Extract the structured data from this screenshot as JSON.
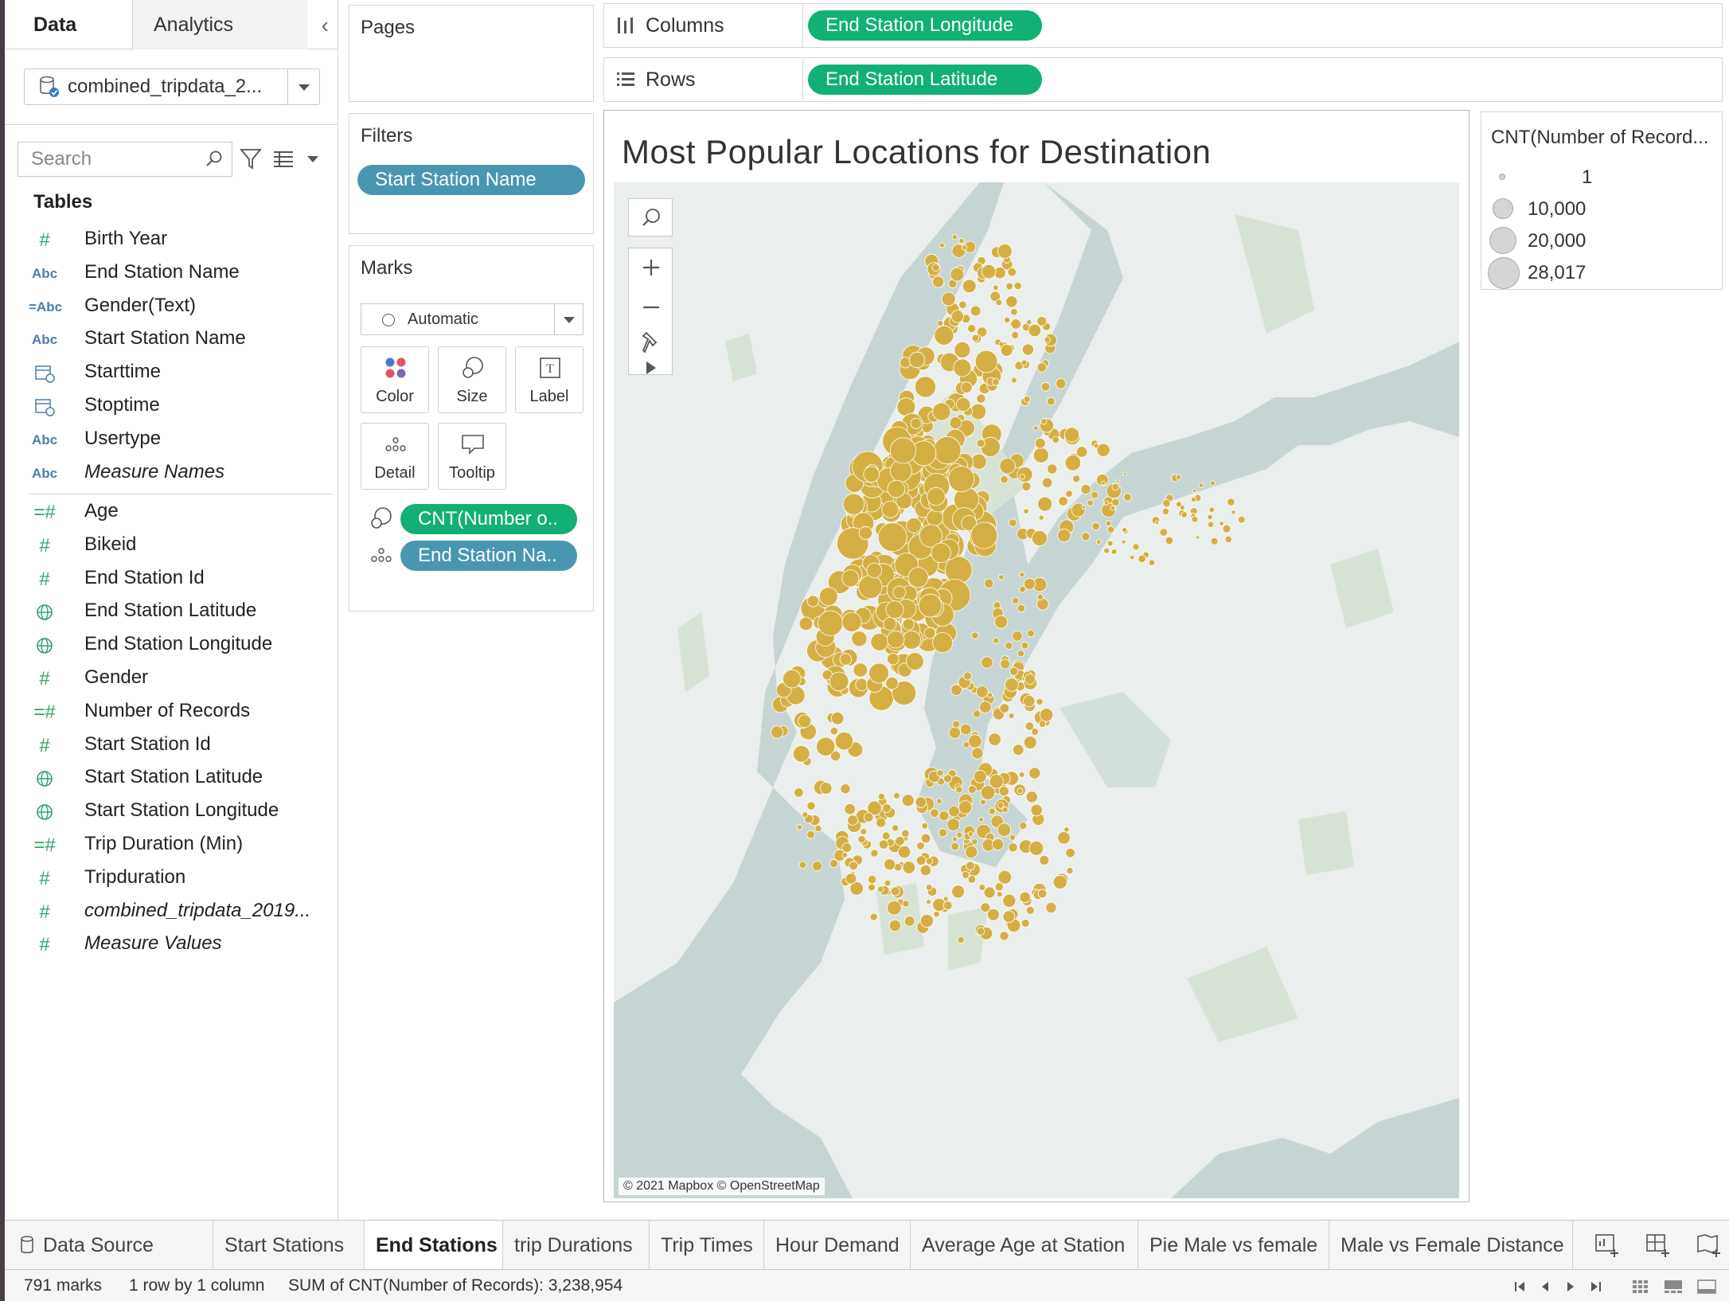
{
  "data_pane": {
    "tabs": [
      "Data",
      "Analytics"
    ],
    "datasource": "combined_tripdata_2...",
    "search_placeholder": "Search",
    "tables_heading": "Tables",
    "dimensions": [
      {
        "type": "#",
        "label": "Birth Year"
      },
      {
        "type": "Abc",
        "label": "End Station Name"
      },
      {
        "type": "=Abc",
        "label": "Gender(Text)"
      },
      {
        "type": "Abc",
        "label": "Start Station Name"
      },
      {
        "type": "date",
        "label": "Starttime"
      },
      {
        "type": "date",
        "label": "Stoptime"
      },
      {
        "type": "Abc",
        "label": "Usertype"
      },
      {
        "type": "Abc",
        "label": "Measure Names",
        "italic": true
      }
    ],
    "measures": [
      {
        "type": "=#",
        "label": "Age"
      },
      {
        "type": "#",
        "label": "Bikeid"
      },
      {
        "type": "#",
        "label": "End Station Id"
      },
      {
        "type": "geo",
        "label": "End Station Latitude"
      },
      {
        "type": "geo",
        "label": "End Station Longitude"
      },
      {
        "type": "#",
        "label": "Gender"
      },
      {
        "type": "=#",
        "label": "Number of Records"
      },
      {
        "type": "#",
        "label": "Start Station Id"
      },
      {
        "type": "geo",
        "label": "Start Station Latitude"
      },
      {
        "type": "geo",
        "label": "Start Station Longitude"
      },
      {
        "type": "=#",
        "label": "Trip Duration (Min)"
      },
      {
        "type": "#",
        "label": "Tripduration"
      },
      {
        "type": "#",
        "label": "combined_tripdata_2019...",
        "italic": true
      },
      {
        "type": "#",
        "label": "Measure Values",
        "italic": true
      }
    ]
  },
  "pages": {
    "title": "Pages"
  },
  "filters": {
    "title": "Filters",
    "pill": "Start Station Name"
  },
  "marks": {
    "title": "Marks",
    "type": "Automatic",
    "buttons": [
      "Color",
      "Size",
      "Label",
      "Detail",
      "Tooltip"
    ],
    "size_pill": "CNT(Number o..",
    "detail_pill": "End Station Na.."
  },
  "columns": {
    "label": "Columns",
    "pill": "End Station Longitude"
  },
  "rows": {
    "label": "Rows",
    "pill": "End Station Latitude"
  },
  "view": {
    "title": "Most Popular Locations for Destination",
    "attribution": "© 2021 Mapbox © OpenStreetMap",
    "mark_color": "#d4b044",
    "water_color": "#c6d5d3"
  },
  "legend": {
    "title": "CNT(Number of Record...",
    "items": [
      "1",
      "10,000",
      "20,000",
      "28,017"
    ]
  },
  "sheet_tabs": {
    "data_source": "Data Source",
    "tabs": [
      "Start Stations",
      "End Stations",
      "trip Durations",
      "Trip Times",
      "Hour Demand",
      "Average Age at Station",
      "Pie Male vs female",
      "Male vs Female Distance"
    ],
    "active": "End Stations"
  },
  "status": {
    "marks": "791 marks",
    "dims": "1 row by 1 column",
    "sum": "SUM of CNT(Number of Records): 3,238,954"
  }
}
